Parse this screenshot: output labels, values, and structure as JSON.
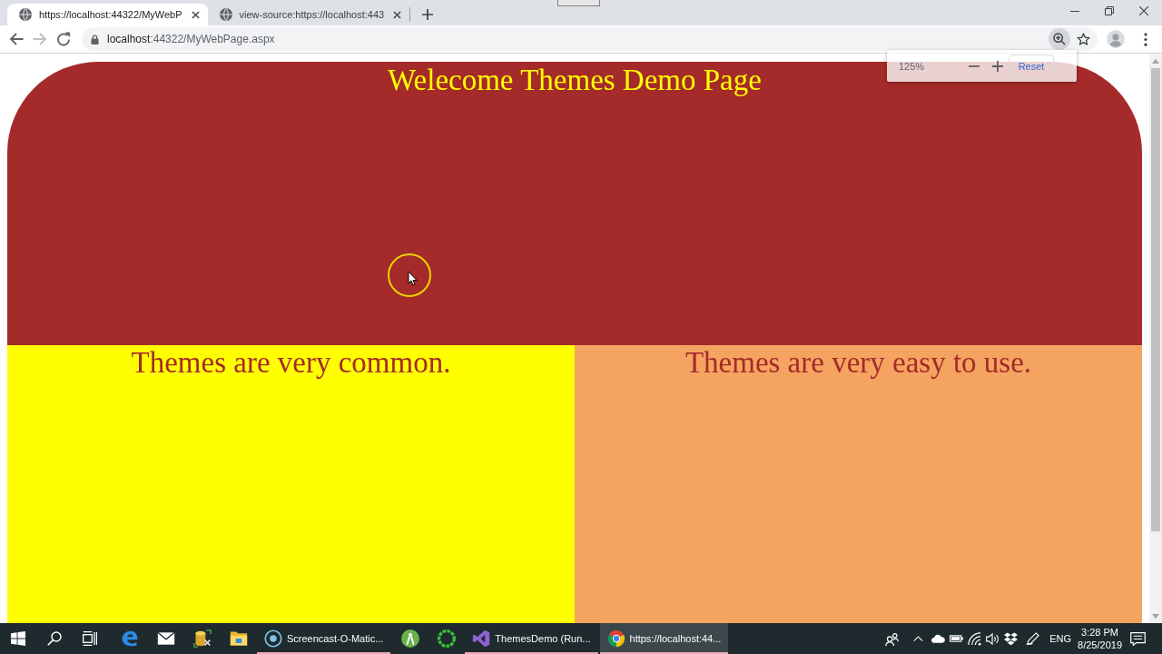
{
  "browser": {
    "tabs": [
      {
        "title": "https://localhost:44322/MyWebP",
        "selected": true
      },
      {
        "title": "view-source:https://localhost:443",
        "selected": false
      }
    ],
    "back": {
      "disabled": false
    },
    "forward": {
      "disabled": true
    },
    "address": {
      "host": "localhost",
      "path": ":44322/MyWebPage.aspx"
    },
    "zoom_popup": {
      "zoom_text": "125%",
      "reset_label": "Reset"
    }
  },
  "page": {
    "header": {
      "title": "Welecome Themes Demo Page"
    },
    "columns": [
      {
        "text": "Themes are very common.",
        "color": "#ffff00"
      },
      {
        "text": "Themes are very easy to use.",
        "color": "#f4a460"
      }
    ]
  },
  "taskbar": {
    "apps": [
      {
        "running": false,
        "selected": false
      },
      {
        "running": false,
        "selected": false
      },
      {
        "running": false,
        "selected": false
      },
      {
        "running": false,
        "selected": false
      },
      {
        "label": "Screencast-O-Matic...",
        "running": true,
        "selected": false
      },
      {
        "running": false,
        "selected": false
      },
      {
        "running": false,
        "selected": false
      },
      {
        "label": "ThemesDemo (Run...",
        "running": true,
        "selected": false
      },
      {
        "label": "https://localhost:44...",
        "running": true,
        "selected": true
      }
    ],
    "tray": {
      "language": "ENG",
      "time": "3:28 PM",
      "date": "8/25/2019"
    }
  }
}
